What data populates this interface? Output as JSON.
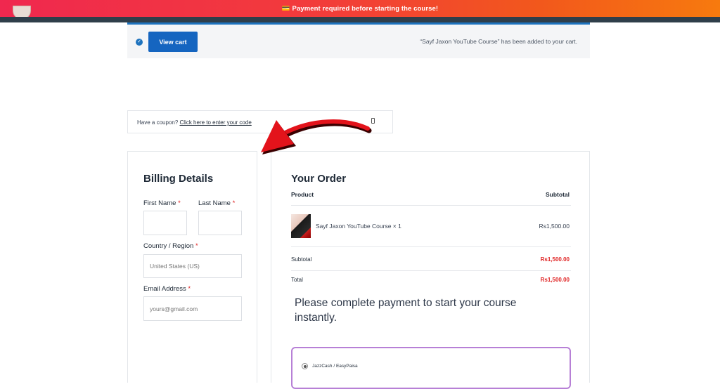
{
  "banner": {
    "icon": "credit-card-emoji",
    "text": "💳 Payment required before starting the course!"
  },
  "notice": {
    "button_label": "View cart",
    "message": "“Sayf Jaxon YouTube Course” has been added to your cart."
  },
  "coupon": {
    "prompt": "Have a coupon?",
    "link": "Click here to enter your code"
  },
  "billing": {
    "title": "Billing Details",
    "first_name_label": "First Name",
    "last_name_label": "Last Name",
    "country_label": "Country / Region",
    "country_placeholder": "United States (US)",
    "email_label": "Email Address",
    "email_placeholder": "yours@gmail.com",
    "required_mark": "*"
  },
  "order": {
    "title": "Your Order",
    "col_product": "Product",
    "col_subtotal": "Subtotal",
    "item_name": "Sayf Jaxon YouTube Course × 1",
    "item_price": "Rs1,500.00",
    "subtotal_label": "Subtotal",
    "subtotal_value": "Rs1,500.00",
    "total_label": "Total",
    "total_value": "Rs1,500.00",
    "payment_message": "Please complete payment to start your course instantly.",
    "payment_option": "JazzCash / EasyPaisa"
  },
  "colors": {
    "accent": "#1565c0",
    "price_red": "#e02424",
    "arrow_red": "#e3131b",
    "payment_border": "#b780d6"
  }
}
